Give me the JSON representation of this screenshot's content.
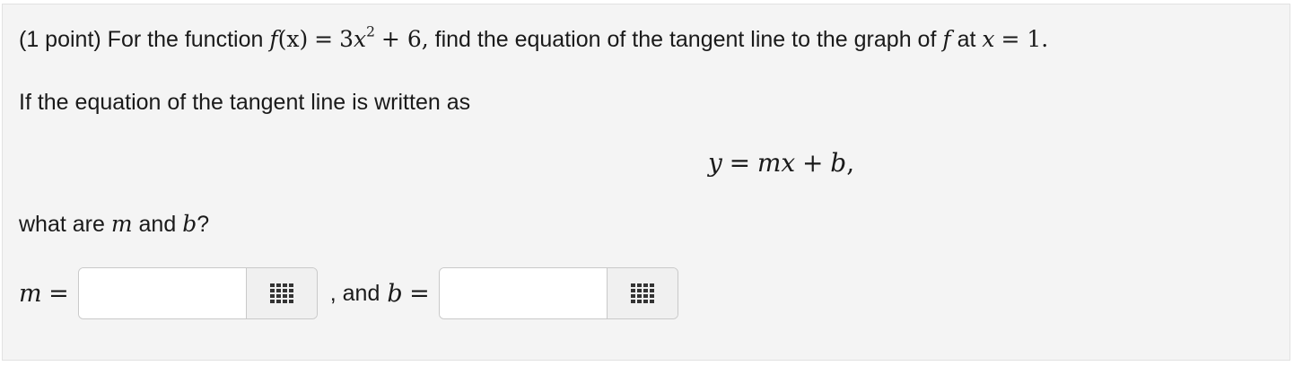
{
  "problem": {
    "line1": {
      "points": "(1 point)",
      "intro": "For the function",
      "f": "f",
      "x_paren": "(x)",
      "equals": "=",
      "coef": "3",
      "var": "x",
      "exponent": "2",
      "plus_const": "+ 6,",
      "rest": "find the equation of the tangent line to the graph of",
      "f2": "f",
      "at": "at",
      "x_var": "x",
      "eq_val": "= 1."
    },
    "line2": "If the equation of the tangent line is written as",
    "display_equation": {
      "y": "y",
      "equals": "=",
      "m": "m",
      "x": "x",
      "plus": "+",
      "b": "b",
      "comma": ","
    },
    "line3": {
      "prefix": "what are",
      "m": "m",
      "and": "and",
      "b": "b",
      "suffix": "?"
    },
    "answers": {
      "m_label_var": "m",
      "m_label_eq": "=",
      "m_value": "",
      "between_text": ", and",
      "b_label_var": "b",
      "b_label_eq": "=",
      "b_value": ""
    }
  },
  "icons": {
    "equation_editor": "grid-icon"
  }
}
